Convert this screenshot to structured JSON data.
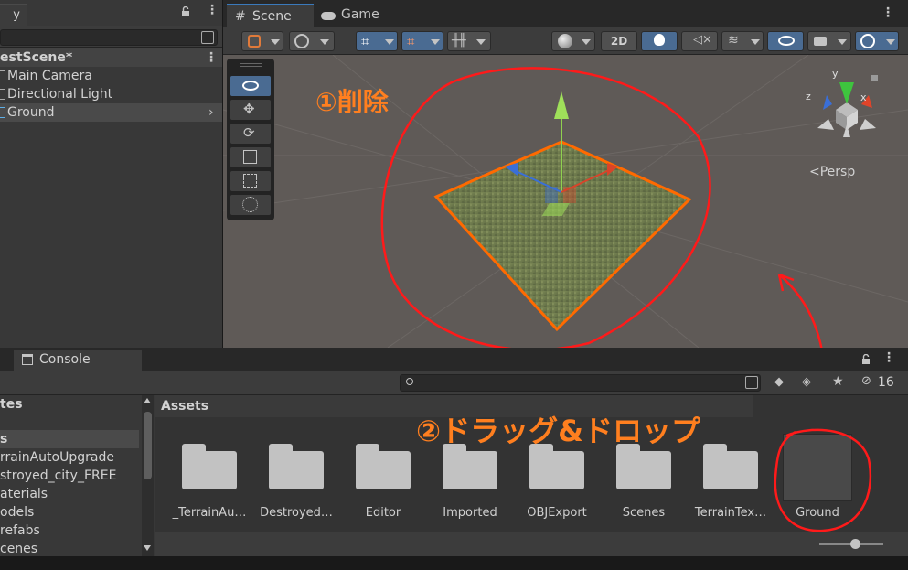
{
  "hierarchy": {
    "tab_label": "y",
    "scene_name": "estScene*",
    "items": [
      {
        "label": "Main Camera"
      },
      {
        "label": "Directional Light"
      },
      {
        "label": "Ground"
      }
    ]
  },
  "scene_view": {
    "tabs": [
      {
        "label": "Scene"
      },
      {
        "label": "Game"
      }
    ],
    "mode_2d_label": "2D",
    "projection_label": "<Persp",
    "axes": {
      "x": "x",
      "y": "y",
      "z": "z"
    }
  },
  "annotations": {
    "step1": "①削除",
    "step2": "②ドラッグ&ドロップ"
  },
  "project": {
    "tabs": [
      {
        "label": "Console"
      }
    ],
    "hidden_count": "16",
    "tree": [
      {
        "label": "tes",
        "bold": true
      },
      {
        "label": "s",
        "bold": true
      },
      {
        "label": "rrainAutoUpgrade"
      },
      {
        "label": "stroyed_city_FREE"
      },
      {
        "label": "aterials"
      },
      {
        "label": "odels"
      },
      {
        "label": "refabs"
      },
      {
        "label": "cenes"
      }
    ],
    "breadcrumb": "Assets",
    "assets": [
      {
        "label": "_TerrainAu…"
      },
      {
        "label": "Destroyed…"
      },
      {
        "label": "Editor"
      },
      {
        "label": "Imported"
      },
      {
        "label": "OBJExport"
      },
      {
        "label": "Scenes"
      },
      {
        "label": "TerrainTex…"
      },
      {
        "label": "Ground"
      }
    ]
  },
  "colors": {
    "accent": "#4a6b92",
    "annotation": "#ff7f1f",
    "annotation_circle": "#ff1a1a",
    "selection_outline": "#ff6a00"
  }
}
